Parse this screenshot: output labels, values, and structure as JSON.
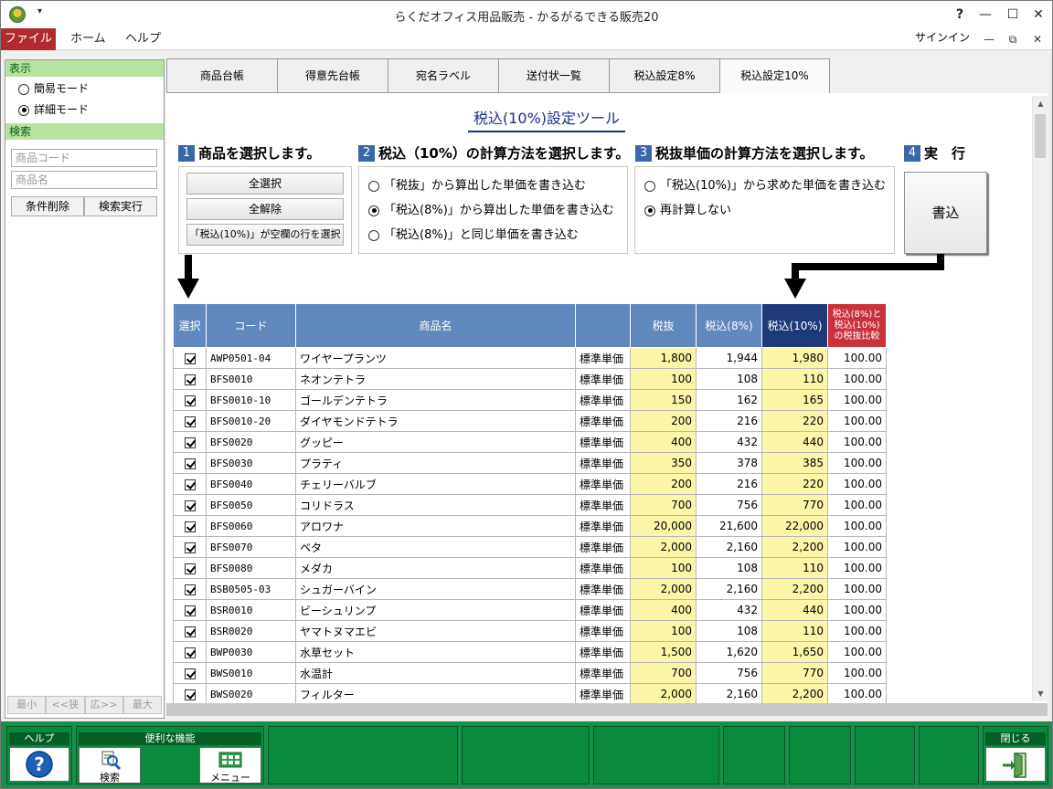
{
  "window": {
    "title": "らくだオフィス用品販売 - かるがるできる販売20",
    "qat": "▾",
    "help_q": "?",
    "minimize": "—",
    "maximize": "☐",
    "close": "✕"
  },
  "ribbon": {
    "tabs": [
      "ファイル",
      "ホーム",
      "ヘルプ"
    ],
    "signin": "サインイン",
    "btn_min": "—",
    "btn_restore": "⧉",
    "btn_close": "✕"
  },
  "left": {
    "display_header": "表示",
    "simple_mode": "簡易モード",
    "detail_mode": "詳細モード",
    "search_header": "検索",
    "code_placeholder": "商品コード",
    "name_placeholder": "商品名",
    "clear_btn": "条件削除",
    "search_btn": "検索実行",
    "pager": [
      "最小",
      "<<狭",
      "広>>",
      "最大"
    ]
  },
  "tabs": [
    "商品台帳",
    "得意先台帳",
    "宛名ラベル",
    "送付状一覧",
    "税込設定8%",
    "税込設定10%"
  ],
  "tool": {
    "title": "税込(10%)設定ツール",
    "steps": [
      {
        "num": "1",
        "label": "商品を選択します。"
      },
      {
        "num": "2",
        "label": "税込（10%）の計算方法を選択します。"
      },
      {
        "num": "3",
        "label": "税抜単価の計算方法を選択します。"
      },
      {
        "num": "4",
        "label": "実　行"
      }
    ],
    "select_all": "全選択",
    "deselect_all": "全解除",
    "select_empty": "「税込(10%)」が空欄の行を選択",
    "opt2": [
      "「税抜」から算出した単価を書き込む",
      "「税込(8%)」から算出した単価を書き込む",
      "「税込(8%)」と同じ単価を書き込む"
    ],
    "opt3": [
      "「税込(10%)」から求めた単価を書き込む",
      "再計算しない"
    ],
    "exec": "書込"
  },
  "table": {
    "headers": {
      "select": "選択",
      "code": "コード",
      "name": "商品名",
      "unit": "",
      "ex": "税抜",
      "t8": "税込(8%)",
      "t10": "税込(10%)",
      "cmp1": "税込(8%)と",
      "cmp2": "税込(10%)",
      "cmp3": "の税抜比較"
    },
    "rows": [
      [
        "AWP0501-04",
        "ワイヤープランツ",
        "標準単価",
        "1,800",
        "1,944",
        "1,980",
        "100.00"
      ],
      [
        "BFS0010",
        "ネオンテトラ",
        "標準単価",
        "100",
        "108",
        "110",
        "100.00"
      ],
      [
        "BFS0010-10",
        "ゴールデンテトラ",
        "標準単価",
        "150",
        "162",
        "165",
        "100.00"
      ],
      [
        "BFS0010-20",
        "ダイヤモンドテトラ",
        "標準単価",
        "200",
        "216",
        "220",
        "100.00"
      ],
      [
        "BFS0020",
        "グッピー",
        "標準単価",
        "400",
        "432",
        "440",
        "100.00"
      ],
      [
        "BFS0030",
        "プラティ",
        "標準単価",
        "350",
        "378",
        "385",
        "100.00"
      ],
      [
        "BFS0040",
        "チェリーバルブ",
        "標準単価",
        "200",
        "216",
        "220",
        "100.00"
      ],
      [
        "BFS0050",
        "コリドラス",
        "標準単価",
        "700",
        "756",
        "770",
        "100.00"
      ],
      [
        "BFS0060",
        "アロワナ",
        "標準単価",
        "20,000",
        "21,600",
        "22,000",
        "100.00"
      ],
      [
        "BFS0070",
        "ベタ",
        "標準単価",
        "2,000",
        "2,160",
        "2,200",
        "100.00"
      ],
      [
        "BFS0080",
        "メダカ",
        "標準単価",
        "100",
        "108",
        "110",
        "100.00"
      ],
      [
        "BSB0505-03",
        "シュガーバイン",
        "標準単価",
        "2,000",
        "2,160",
        "2,200",
        "100.00"
      ],
      [
        "BSR0010",
        "ビーシュリンプ",
        "標準単価",
        "400",
        "432",
        "440",
        "100.00"
      ],
      [
        "BSR0020",
        "ヤマトヌマエビ",
        "標準単価",
        "100",
        "108",
        "110",
        "100.00"
      ],
      [
        "BWP0030",
        "水草セット",
        "標準単価",
        "1,500",
        "1,620",
        "1,650",
        "100.00"
      ],
      [
        "BWS0010",
        "水温計",
        "標準単価",
        "700",
        "756",
        "770",
        "100.00"
      ],
      [
        "BWS0020",
        "フィルター",
        "標準単価",
        "2,000",
        "2,160",
        "2,200",
        "100.00"
      ]
    ]
  },
  "footer": {
    "help_label": "ヘルプ",
    "tools_label": "便利な機能",
    "search_btn": "検索",
    "menu_btn": "メニュー",
    "close_label": "閉じる"
  },
  "colors": {
    "file_tab": "#b02a30",
    "header_blue": "#5f88bf",
    "header_dark": "#1e3a7a",
    "header_red": "#c9323b",
    "cell_yellow": "#fbf6a8",
    "footer_green": "#0a8a3f"
  }
}
